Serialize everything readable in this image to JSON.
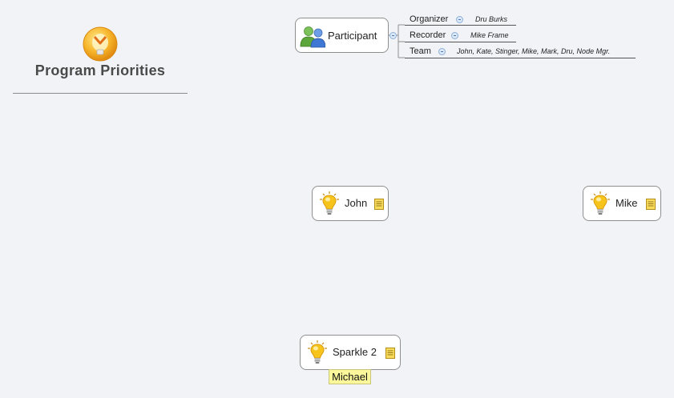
{
  "central": {
    "title": "Program Priorities",
    "icon": "mindmap-logo-icon"
  },
  "participant": {
    "title": "Participant",
    "icon": "users-group-icon",
    "properties": [
      {
        "label": "Organizer",
        "value": "Dru Burks"
      },
      {
        "label": "Recorder",
        "value": "Mike Frame"
      },
      {
        "label": "Team",
        "value": "John, Kate, Stinger, Mike, Mark, Dru, Node Mgr."
      }
    ]
  },
  "topics": {
    "john": {
      "label": "John",
      "icon": "lightbulb-icon",
      "note_icon": "note-icon"
    },
    "mike": {
      "label": "Mike",
      "icon": "lightbulb-icon",
      "note_icon": "note-icon"
    },
    "sparkle": {
      "label": "Sparkle 2",
      "icon": "lightbulb-icon",
      "note_icon": "note-icon",
      "callout": "Michael"
    }
  },
  "colors": {
    "background": "#f1f3f7",
    "topic_border": "#8f8f8f",
    "callout_fill": "#fbf79a",
    "bulb": "#f6c21a",
    "collapse_button": "#8db0d8"
  }
}
